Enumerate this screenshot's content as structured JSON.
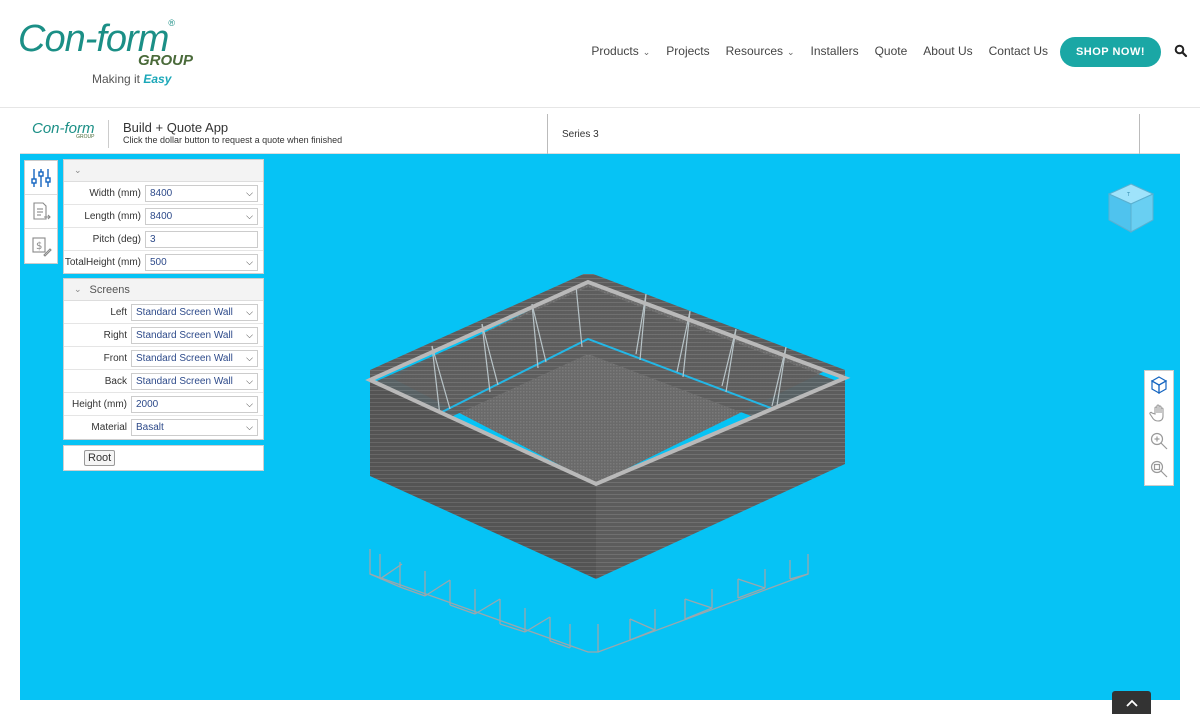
{
  "brand": {
    "logo_main": "Con-form",
    "logo_reg": "®",
    "logo_group": "GROUP",
    "tagline_prefix": "Making it ",
    "tagline_emph": "Easy"
  },
  "nav": {
    "items": [
      {
        "label": "Products",
        "has_caret": true
      },
      {
        "label": "Projects",
        "has_caret": false
      },
      {
        "label": "Resources",
        "has_caret": true
      },
      {
        "label": "Installers",
        "has_caret": false
      },
      {
        "label": "Quote",
        "has_caret": false
      },
      {
        "label": "About Us",
        "has_caret": false
      },
      {
        "label": "Contact Us",
        "has_caret": false
      }
    ],
    "caret": "⌄",
    "shop_label": "SHOP NOW!",
    "search_icon": "search-icon"
  },
  "app": {
    "logo_main": "Con-form",
    "logo_group": "GROUP",
    "title": "Build + Quote App",
    "subtitle": "Click the dollar button to request a quote when finished",
    "series": "Series 3"
  },
  "tools": {
    "left": [
      "sliders-icon",
      "document-export-icon",
      "dollar-edit-icon"
    ],
    "right": [
      "3d-cube-icon",
      "pan-hand-icon",
      "zoom-in-icon",
      "zoom-fit-icon"
    ]
  },
  "dimensions_panel": {
    "rows": [
      {
        "label": "Width (mm)",
        "value": "8400",
        "type": "select"
      },
      {
        "label": "Length (mm)",
        "value": "8400",
        "type": "select"
      },
      {
        "label": "Pitch (deg)",
        "value": "3",
        "type": "input"
      },
      {
        "label": "TotalHeight (mm)",
        "value": "500",
        "type": "select"
      }
    ]
  },
  "screens_panel": {
    "title": "Screens",
    "rows": [
      {
        "label": "Left",
        "value": "Standard Screen Wall"
      },
      {
        "label": "Right",
        "value": "Standard Screen Wall"
      },
      {
        "label": "Front",
        "value": "Standard Screen Wall"
      },
      {
        "label": "Back",
        "value": "Standard Screen Wall"
      },
      {
        "label": "Height (mm)",
        "value": "2000"
      },
      {
        "label": "Material",
        "value": "Basalt"
      }
    ]
  },
  "root_button": "Root",
  "colors": {
    "viewport": "#06c3f5",
    "accent": "#1aa7a5",
    "wall": "#6b6b6b"
  }
}
